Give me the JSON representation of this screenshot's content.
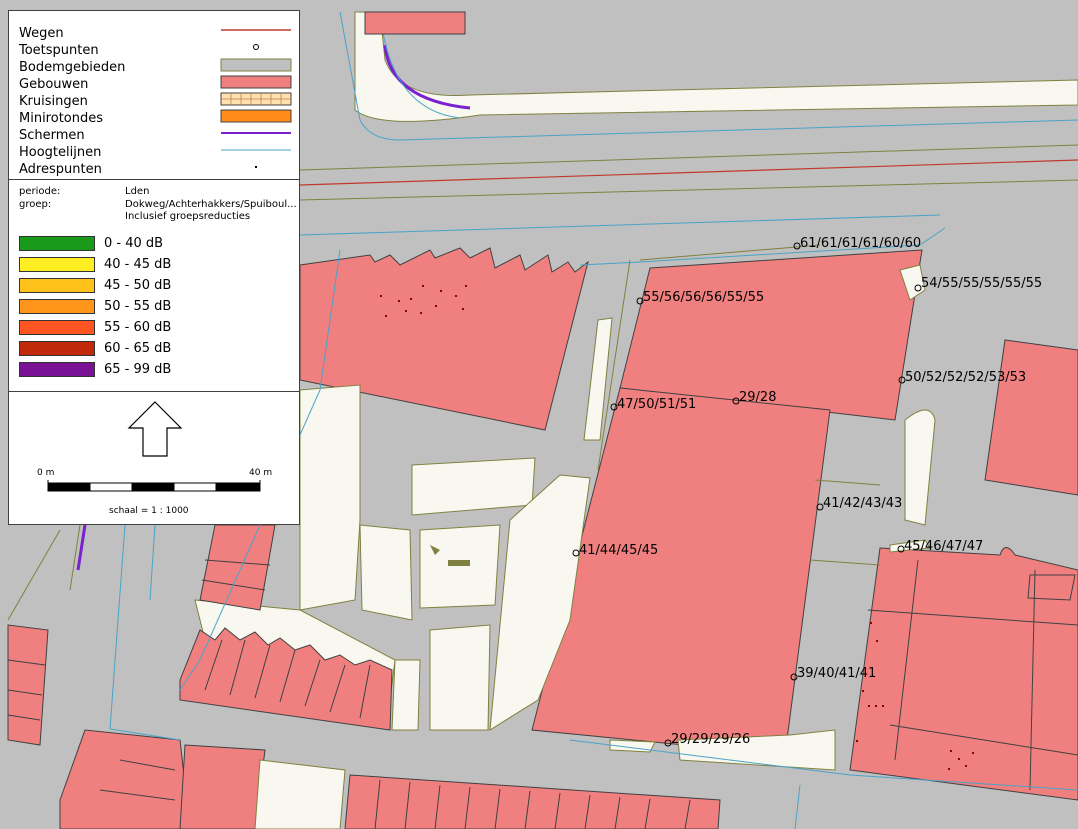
{
  "legend": {
    "items": [
      {
        "label": "Wegen",
        "icon": "road-line",
        "color": "#c0392b"
      },
      {
        "label": "Toetspunten",
        "icon": "test-point-symbol",
        "color": "#000000"
      },
      {
        "label": "Bodemgebieden",
        "icon": "ground-area-fill",
        "color": "#c0c0c0"
      },
      {
        "label": "Gebouwen",
        "icon": "building-fill",
        "color": "#f08080"
      },
      {
        "label": "Kruisingen",
        "icon": "crossing-hatch",
        "color": "#ffe0b0"
      },
      {
        "label": "Minirotondes",
        "icon": "roundabout-fill",
        "color": "#ff8c1a"
      },
      {
        "label": "Schermen",
        "icon": "screen-line",
        "color": "#7b1fd0"
      },
      {
        "label": "Hoogtelijnen",
        "icon": "height-line",
        "color": "#4aa3c8"
      },
      {
        "label": "Adrespunten",
        "icon": "address-dot",
        "color": "#000000"
      }
    ]
  },
  "info": {
    "periode_label": "periode:",
    "periode_value": "Lden",
    "groep_label": "groep:",
    "groep_value": "Dokweg/Achterhakkers/Spuiboul...",
    "groep_note": "Inclusief groepsreducties"
  },
  "noise_classes": [
    {
      "label": "0 - 40 dB",
      "color": "#1a9a1a"
    },
    {
      "label": "40 - 45 dB",
      "color": "#ffee22"
    },
    {
      "label": "45 - 50 dB",
      "color": "#ffc21a"
    },
    {
      "label": "50 - 55 dB",
      "color": "#ff951a"
    },
    {
      "label": "55 - 60 dB",
      "color": "#ff5522"
    },
    {
      "label": "60 - 65 dB",
      "color": "#c02a0a"
    },
    {
      "label": "65 - 99 dB",
      "color": "#7a1296"
    }
  ],
  "navigation": {
    "north_icon": "north-arrow-icon",
    "scale_start": "0 m",
    "scale_end": "40 m",
    "scale_text": "schaal = 1 : 1000"
  },
  "test_points": [
    {
      "label": "61/61/61/61/60/60"
    },
    {
      "label": "54/55/55/55/55/55"
    },
    {
      "label": "55/56/56/56/55/55"
    },
    {
      "label": "50/52/52/52/53/53"
    },
    {
      "label": "47/50/51/51"
    },
    {
      "label": "29/28"
    },
    {
      "label": "41/42/43/43"
    },
    {
      "label": "45/46/47/47"
    },
    {
      "label": "41/44/45/45"
    },
    {
      "label": "39/40/41/41"
    },
    {
      "label": "29/29/29/26"
    }
  ]
}
